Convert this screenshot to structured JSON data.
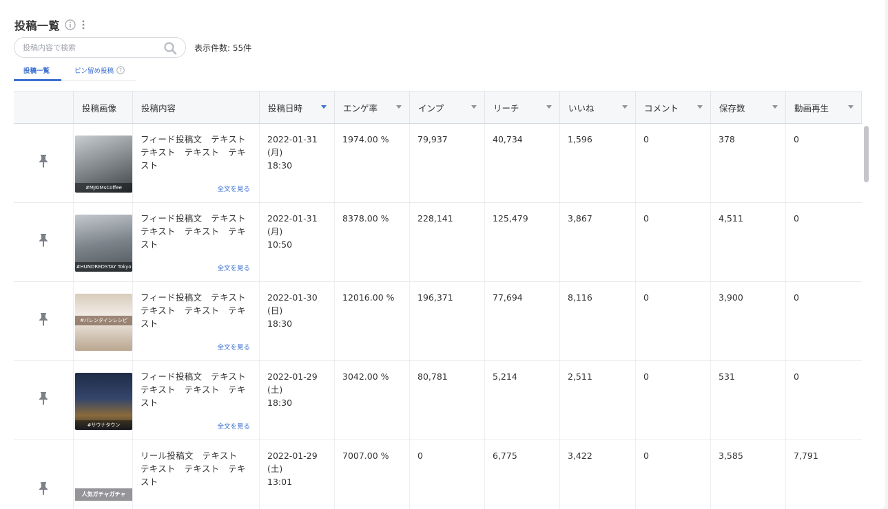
{
  "header": {
    "title": "投稿一覧",
    "count_text": "表示件数: 55件"
  },
  "search": {
    "placeholder": "投稿内容で検索"
  },
  "tabs": [
    {
      "label": "投稿一覧"
    },
    {
      "label": "ピン留め投稿"
    }
  ],
  "columns": [
    "投稿画像",
    "投稿内容",
    "投稿日時",
    "エンゲ率",
    "インプ",
    "リーチ",
    "いいね",
    "コメント",
    "保存数",
    "動画再生"
  ],
  "more_label": "全文を見る",
  "accent_color": "#3b6fd1",
  "rows": [
    {
      "thumb_caption": "#MJKIMsCoffee",
      "thumb_color": "#8a8f93",
      "content": "フィード投稿文　テキスト　テキスト　テキスト　テキスト",
      "date": "2022-01-31",
      "weekday": "(月)",
      "time": "18:30",
      "engagement": "1974.00 %",
      "impressions": "79,937",
      "reach": "40,734",
      "likes": "1,596",
      "comments": "0",
      "saves": "378",
      "video": "0"
    },
    {
      "thumb_caption": "#HUNDREDSTAY Tokyo",
      "thumb_color": "#6f7780",
      "content": "フィード投稿文　テキスト　テキスト　テキスト　テキスト",
      "date": "2022-01-31",
      "weekday": "(月)",
      "time": "10:50",
      "engagement": "8378.00 %",
      "impressions": "228,141",
      "reach": "125,479",
      "likes": "3,867",
      "comments": "0",
      "saves": "4,511",
      "video": "0"
    },
    {
      "thumb_caption": "#バレンタインレシピ",
      "thumb_color": "#b9a68f",
      "content": "フィード投稿文　テキスト　テキスト　テキスト　テキスト",
      "date": "2022-01-30",
      "weekday": "(日)",
      "time": "18:30",
      "engagement": "12016.00 %",
      "impressions": "196,371",
      "reach": "77,694",
      "likes": "8,116",
      "comments": "0",
      "saves": "3,900",
      "video": "0"
    },
    {
      "thumb_caption": "#サウナタウン",
      "thumb_color": "#2b3a5a",
      "content": "フィード投稿文　テキスト　テキスト　テキスト　テキスト",
      "date": "2022-01-29",
      "weekday": "(土)",
      "time": "18:30",
      "engagement": "3042.00 %",
      "impressions": "80,781",
      "reach": "5,214",
      "likes": "2,511",
      "comments": "0",
      "saves": "531",
      "video": "0"
    },
    {
      "thumb_caption": "人気ガチャガチャ",
      "thumb_color": "#d9b8a8",
      "content": "リール投稿文　テキスト　テキスト　テキスト　テキスト",
      "date": "2022-01-29",
      "weekday": "(土)",
      "time": "13:01",
      "engagement": "7007.00 %",
      "impressions": "0",
      "reach": "6,775",
      "likes": "3,422",
      "comments": "0",
      "saves": "3,585",
      "video": "7,791"
    }
  ]
}
